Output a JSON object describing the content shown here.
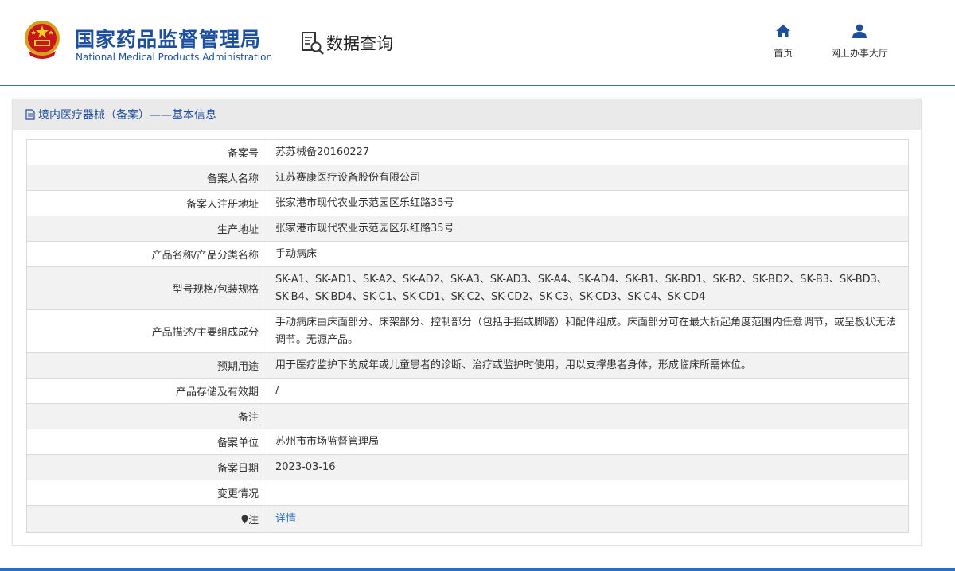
{
  "header": {
    "title": "国家药品监督管理局",
    "subtitle": "National Medical Products Administration",
    "query_label": "数据查询",
    "nav": [
      {
        "label": "首页",
        "icon": "home-icon"
      },
      {
        "label": "网上办事大厅",
        "icon": "user-icon"
      }
    ]
  },
  "panel": {
    "title": "境内医疗器械（备案）——基本信息"
  },
  "rows": [
    {
      "label": "备案号",
      "value": "苏苏械备20160227"
    },
    {
      "label": "备案人名称",
      "value": "江苏赛康医疗设备股份有限公司"
    },
    {
      "label": "备案人注册地址",
      "value": "张家港市现代农业示范园区乐红路35号"
    },
    {
      "label": "生产地址",
      "value": "张家港市现代农业示范园区乐红路35号"
    },
    {
      "label": "产品名称/产品分类名称",
      "value": "手动病床"
    },
    {
      "label": "型号规格/包装规格",
      "value": "SK-A1、SK-AD1、SK-A2、SK-AD2、SK-A3、SK-AD3、SK-A4、SK-AD4、SK-B1、SK-BD1、SK-B2、SK-BD2、SK-B3、SK-BD3、SK-B4、SK-BD4、SK-C1、SK-CD1、SK-C2、SK-CD2、SK-C3、SK-CD3、SK-C4、SK-CD4"
    },
    {
      "label": "产品描述/主要组成成分",
      "value": "手动病床由床面部分、床架部分、控制部分（包括手摇或脚踏）和配件组成。床面部分可在最大折起角度范围内任意调节，或呈板状无法调节。无源产品。"
    },
    {
      "label": "预期用途",
      "value": "用于医疗监护下的成年或儿童患者的诊断、治疗或监护时使用，用以支撑患者身体，形成临床所需体位。"
    },
    {
      "label": "产品存储及有效期",
      "value": "/"
    },
    {
      "label": "备注",
      "value": ""
    },
    {
      "label": "备案单位",
      "value": "苏州市市场监督管理局"
    },
    {
      "label": "备案日期",
      "value": "2023-03-16"
    },
    {
      "label": "变更情况",
      "value": ""
    },
    {
      "label": "注",
      "value": "详情",
      "icon": "pin-icon"
    }
  ],
  "colors": {
    "brand": "#1d4f9e",
    "accent": "#2a6fc9"
  }
}
